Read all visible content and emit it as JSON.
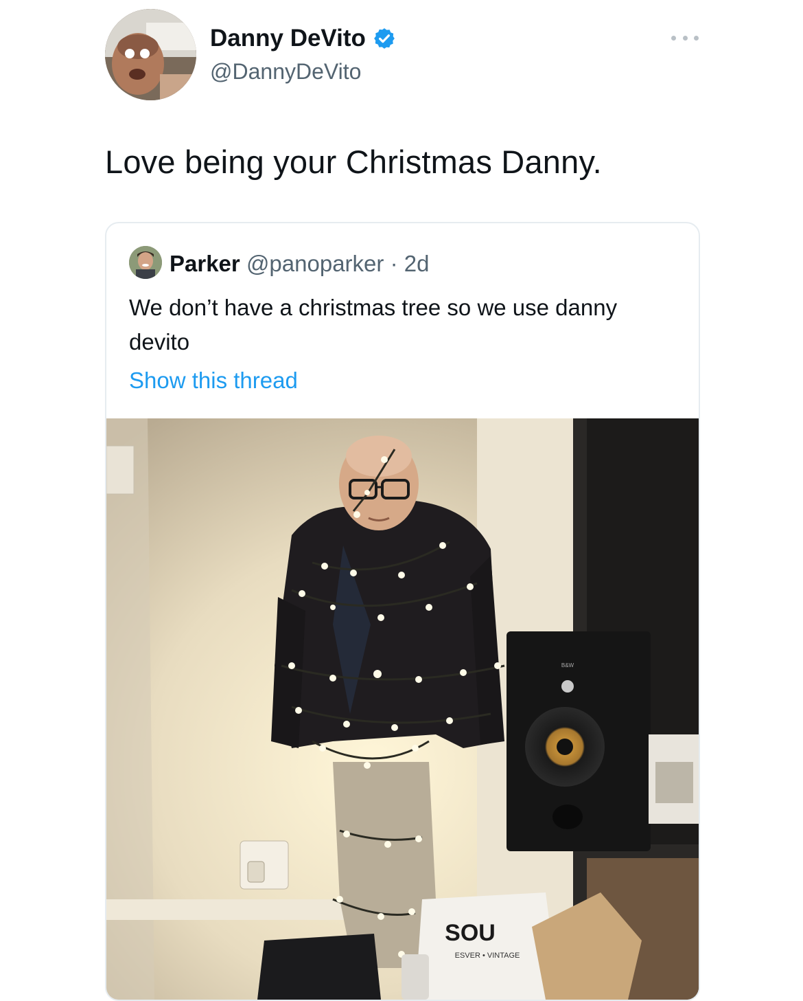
{
  "tweet": {
    "author": {
      "name": "Danny DeVito",
      "handle": "@DannyDeVito",
      "verified": true,
      "avatar_icon": "profile-photo"
    },
    "text": "Love being your Christmas Danny.",
    "more_icon": "more-options-icon"
  },
  "quoted_tweet": {
    "author": {
      "name": "Parker",
      "handle": "@panoparker",
      "separator": "·",
      "time": "2d",
      "avatar_icon": "profile-photo"
    },
    "text": "We don’t have a christmas tree so we use danny devito",
    "show_thread_label": "Show this thread",
    "photo": {
      "description_icon": "photo",
      "bag_brand": "SOU",
      "bag_tagline": "ESVER • VINTAGE",
      "speaker_brand": "B&W"
    }
  },
  "colors": {
    "link": "#1d9bf0",
    "verified": "#1d9bf0",
    "secondary_text": "#536471",
    "primary_text": "#0f1419",
    "border": "#e6ecf0"
  }
}
